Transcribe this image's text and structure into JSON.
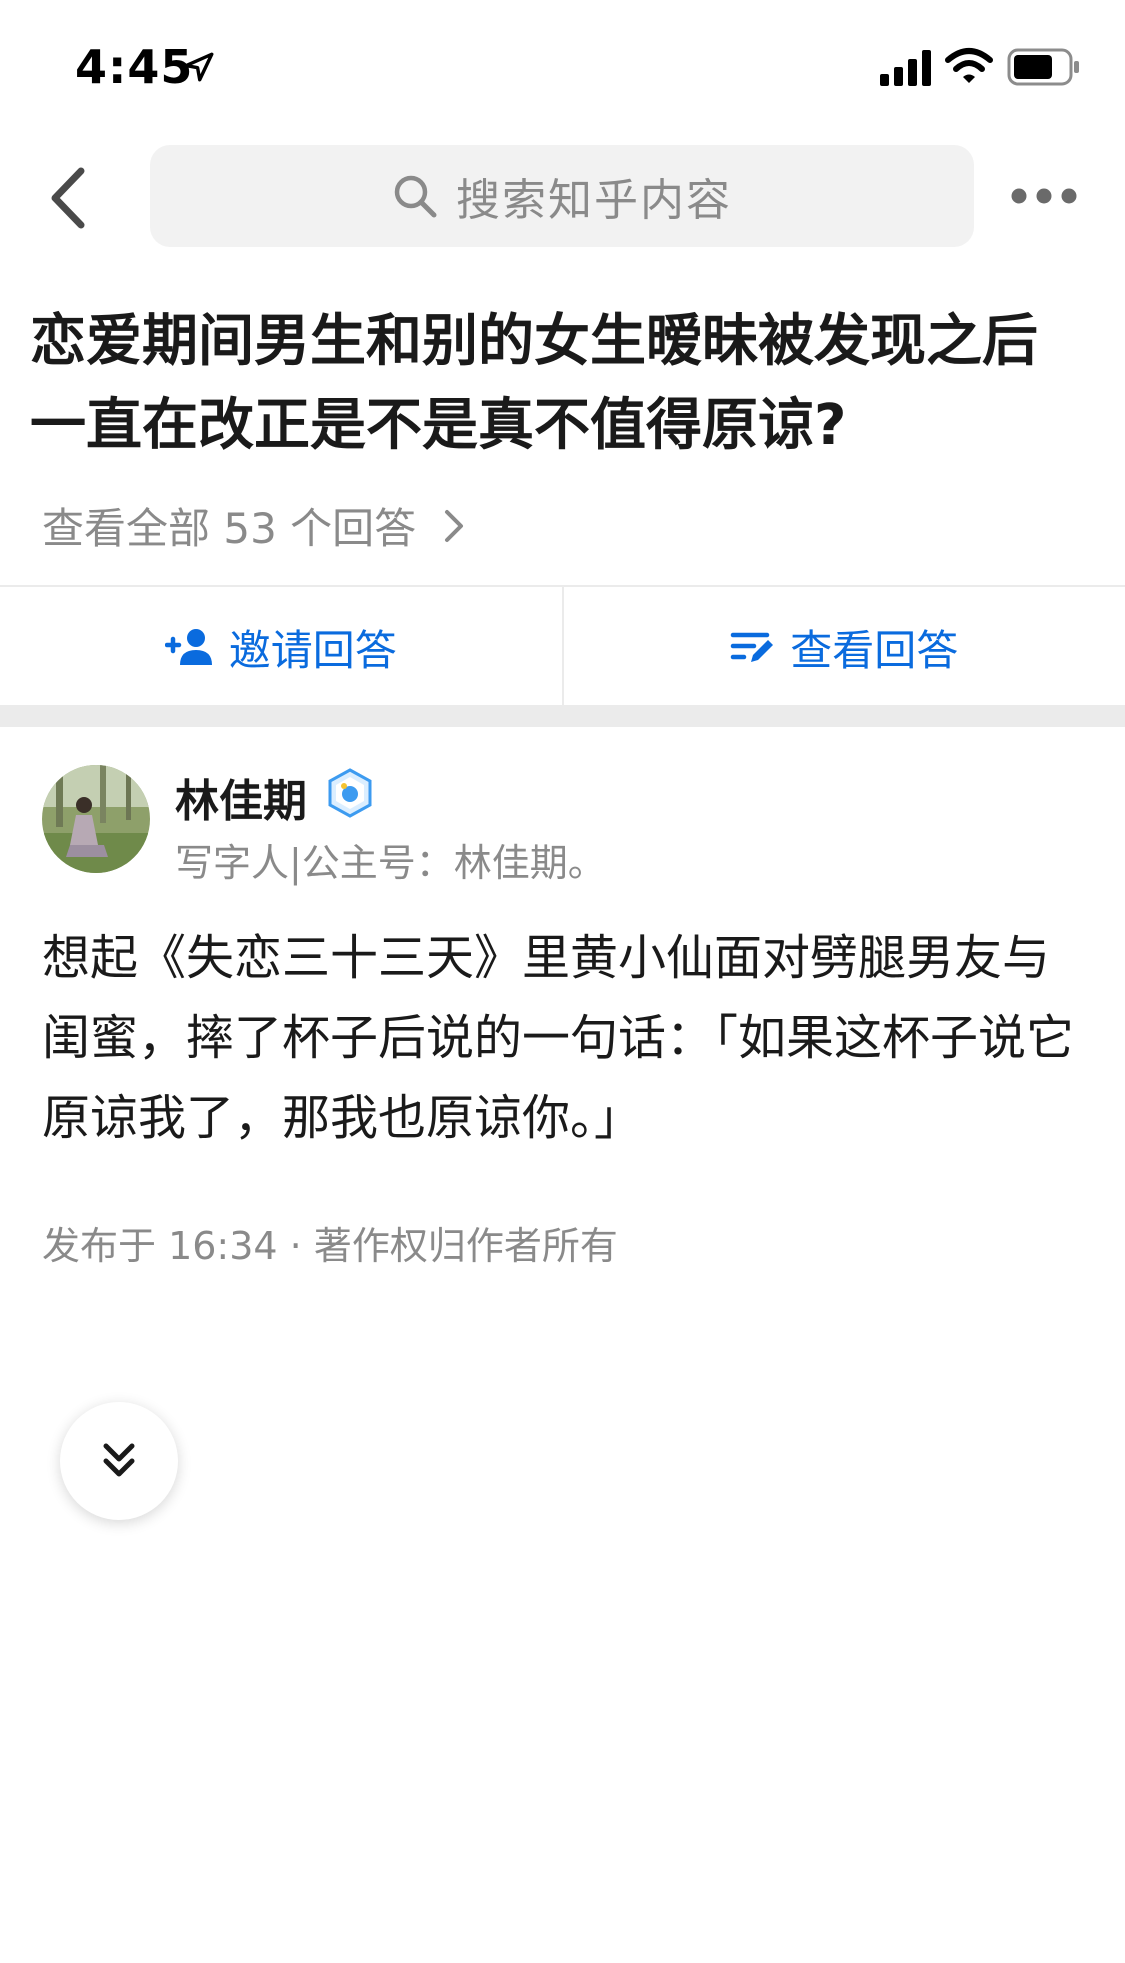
{
  "status_bar": {
    "time": "4:45"
  },
  "nav": {
    "search_placeholder": "搜索知乎内容"
  },
  "question": {
    "title": "恋爱期间男生和别的女生暧昧被发现之后一直在改正是不是真不值得原谅?",
    "view_all": "查看全部 53 个回答"
  },
  "actions": {
    "invite_label": "邀请回答",
    "view_label": "查看回答"
  },
  "answer": {
    "author_name": "林佳期",
    "author_bio": "写字人|公主号：林佳期。",
    "body": "想起《失恋三十三天》里黄小仙面对劈腿男友与闺蜜，摔了杯子后说的一句话：「如果这杯子说它原谅我了，那我也原谅你。」",
    "meta": "发布于 16:34 · 著作权归作者所有"
  },
  "colors": {
    "accent": "#0a6bde",
    "secondary_text": "#8a8a8a",
    "search_bg": "#f2f2f2",
    "divider": "#ebebeb"
  },
  "icons": {
    "back": "chevron-left-icon",
    "search": "search-icon",
    "more": "more-dots-icon",
    "invite": "add-person-icon",
    "view": "edit-lines-icon",
    "verify": "verified-badge-icon",
    "collapse": "double-chevron-down-icon"
  }
}
